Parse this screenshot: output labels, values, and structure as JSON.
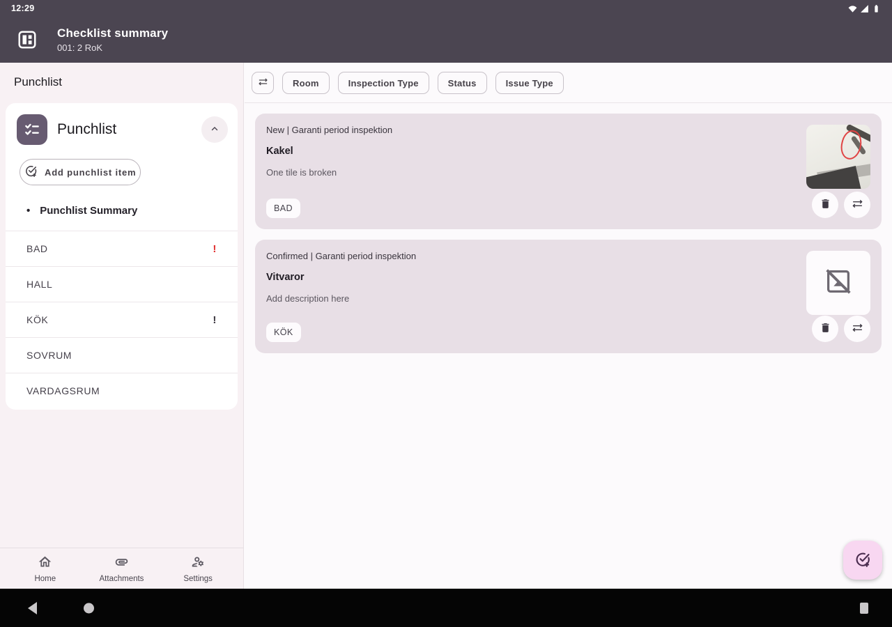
{
  "status_bar": {
    "time": "12:29"
  },
  "app_bar": {
    "title": "Checklist summary",
    "subtitle": "001: 2 RoK"
  },
  "sidebar": {
    "heading": "Punchlist",
    "panel": {
      "title": "Punchlist",
      "add_button_label": "Add punchlist item",
      "summary_bullet": "•",
      "summary_label": "Punchlist Summary",
      "rooms": [
        {
          "label": "BAD",
          "alert": "!"
        },
        {
          "label": "HALL",
          "alert": ""
        },
        {
          "label": "KÖK",
          "alert": "!"
        },
        {
          "label": "SOVRUM",
          "alert": ""
        },
        {
          "label": "VARDAGSRUM",
          "alert": ""
        }
      ]
    },
    "bottom_nav": [
      {
        "label": "Home",
        "icon": "home-icon"
      },
      {
        "label": "Attachments",
        "icon": "attachment-icon"
      },
      {
        "label": "Settings",
        "icon": "manage-accounts-icon"
      }
    ]
  },
  "main": {
    "filters": [
      "Room",
      "Inspection Type",
      "Status",
      "Issue Type"
    ],
    "filter_icon": "sort-filter-icon",
    "cards": [
      {
        "status": "New | Garanti period inspektion",
        "title": "Kakel",
        "description": "One tile is broken",
        "room_chip": "BAD",
        "has_image": true,
        "image_note": "photo of broken tile with red circle annotation"
      },
      {
        "status": "Confirmed | Garanti period inspektion",
        "title": "Vitvaror",
        "description": "Add description here",
        "room_chip": "KÖK",
        "has_image": false
      }
    ],
    "fab_icon": "add-punchlist-item-icon"
  },
  "colors": {
    "app_bar_bg": "#4B4551",
    "sidebar_bg": "#F8F1F4",
    "card_bg": "#E8DFE6",
    "accent_purple": "#675B71",
    "fab_bg": "#F8D7F1",
    "alert_red": "#E02B2B"
  }
}
